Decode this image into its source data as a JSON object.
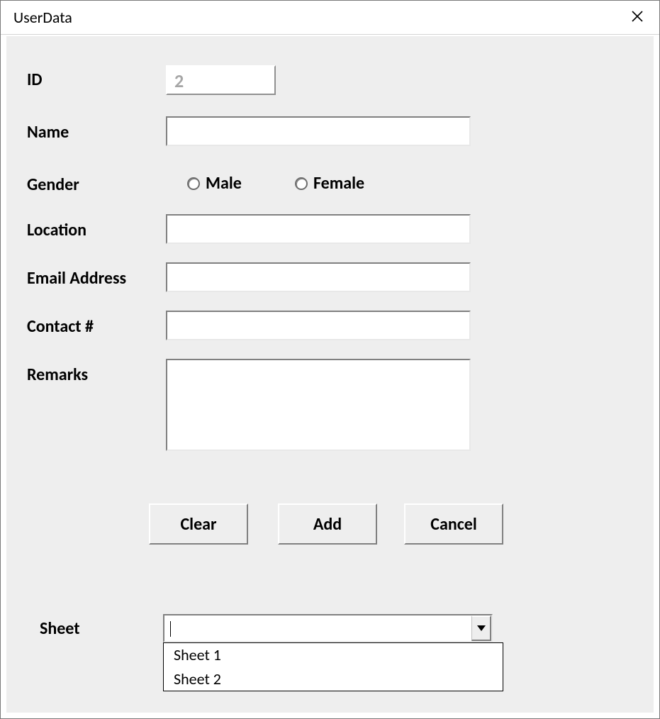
{
  "window": {
    "title": "UserData"
  },
  "labels": {
    "id": "ID",
    "name": "Name",
    "gender": "Gender",
    "location": "Location",
    "email": "Email Address",
    "contact": "Contact #",
    "remarks": "Remarks",
    "sheet": "Sheet"
  },
  "fields": {
    "id": "2",
    "name": "",
    "location": "",
    "email": "",
    "contact": "",
    "remarks": "",
    "sheet_selected": ""
  },
  "gender": {
    "male": "Male",
    "female": "Female"
  },
  "buttons": {
    "clear": "Clear",
    "add": "Add",
    "cancel": "Cancel"
  },
  "sheet_options": [
    "Sheet 1",
    "Sheet 2"
  ]
}
